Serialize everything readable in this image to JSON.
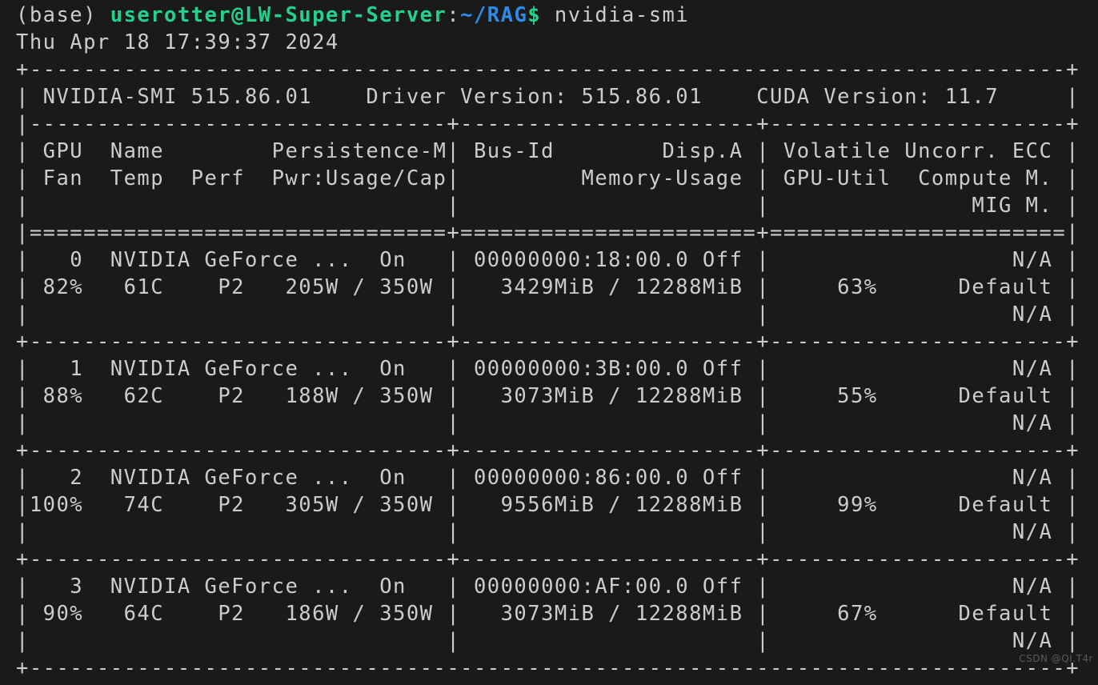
{
  "terminal": {
    "background_color": "#1a1a1a",
    "foreground_color": "#cccccc",
    "prompt_user_color": "#23d18b",
    "prompt_path_color": "#2e8ae8",
    "env_prefix": "(base) ",
    "user_host": "userotter@LW-Super-Server",
    "colon": ":",
    "path": "~/RAG",
    "dollar": "$",
    "command": " nvidia-smi",
    "timestamp": "Thu Apr 18 17:39:37 2024"
  },
  "smi": {
    "border_top": "+-----------------------------------------------------------------------------+",
    "banner": "| NVIDIA-SMI 515.86.01    Driver Version: 515.86.01    CUDA Version: 11.7     |",
    "banner_sep": "|-------------------------------+----------------------+----------------------+",
    "header_line_1": "| GPU  Name        Persistence-M| Bus-Id        Disp.A | Volatile Uncorr. ECC |",
    "header_line_2": "| Fan  Temp  Perf  Pwr:Usage/Cap|         Memory-Usage | GPU-Util  Compute M. |",
    "header_line_3": "|                               |                      |               MIG M. |",
    "header_sep": "|===============================+======================+======================|",
    "row_sep": "+-------------------------------+----------------------+----------------------+",
    "border_bottom": "+-----------------------------------------------------------------------------+",
    "version": "515.86.01",
    "driver_version": "515.86.01",
    "cuda_version": "11.7",
    "columns": [
      "GPU",
      "Name",
      "Persistence-M",
      "Bus-Id",
      "Disp.A",
      "Volatile Uncorr. ECC",
      "Fan",
      "Temp",
      "Perf",
      "Pwr:Usage/Cap",
      "Memory-Usage",
      "GPU-Util",
      "Compute M.",
      "MIG M."
    ],
    "gpus": [
      {
        "index": "0",
        "name": "NVIDIA GeForce ...",
        "persistence_m": "On",
        "bus_id": "00000000:18:00.0",
        "disp_a": "Off",
        "ecc": "N/A",
        "fan": "82%",
        "temp": "61C",
        "perf": "P2",
        "pwr_usage_cap": "205W / 350W",
        "memory_usage": "3429MiB / 12288MiB",
        "gpu_util": "63%",
        "compute_m": "Default",
        "mig_m": "N/A",
        "line1": "|   0  NVIDIA GeForce ...  On   | 00000000:18:00.0 Off |                  N/A |",
        "line2": "| 82%   61C    P2   205W / 350W |   3429MiB / 12288MiB |     63%      Default |",
        "line3": "|                               |                      |                  N/A |"
      },
      {
        "index": "1",
        "name": "NVIDIA GeForce ...",
        "persistence_m": "On",
        "bus_id": "00000000:3B:00.0",
        "disp_a": "Off",
        "ecc": "N/A",
        "fan": "88%",
        "temp": "62C",
        "perf": "P2",
        "pwr_usage_cap": "188W / 350W",
        "memory_usage": "3073MiB / 12288MiB",
        "gpu_util": "55%",
        "compute_m": "Default",
        "mig_m": "N/A",
        "line1": "|   1  NVIDIA GeForce ...  On   | 00000000:3B:00.0 Off |                  N/A |",
        "line2": "| 88%   62C    P2   188W / 350W |   3073MiB / 12288MiB |     55%      Default |",
        "line3": "|                               |                      |                  N/A |"
      },
      {
        "index": "2",
        "name": "NVIDIA GeForce ...",
        "persistence_m": "On",
        "bus_id": "00000000:86:00.0",
        "disp_a": "Off",
        "ecc": "N/A",
        "fan": "100%",
        "temp": "74C",
        "perf": "P2",
        "pwr_usage_cap": "305W / 350W",
        "memory_usage": "9556MiB / 12288MiB",
        "gpu_util": "99%",
        "compute_m": "Default",
        "mig_m": "N/A",
        "line1": "|   2  NVIDIA GeForce ...  On   | 00000000:86:00.0 Off |                  N/A |",
        "line2": "|100%   74C    P2   305W / 350W |   9556MiB / 12288MiB |     99%      Default |",
        "line3": "|                               |                      |                  N/A |"
      },
      {
        "index": "3",
        "name": "NVIDIA GeForce ...",
        "persistence_m": "On",
        "bus_id": "00000000:AF:00.0",
        "disp_a": "Off",
        "ecc": "N/A",
        "fan": "90%",
        "temp": "64C",
        "perf": "P2",
        "pwr_usage_cap": "186W / 350W",
        "memory_usage": "3073MiB / 12288MiB",
        "gpu_util": "67%",
        "compute_m": "Default",
        "mig_m": "N/A",
        "line1": "|   3  NVIDIA GeForce ...  On   | 00000000:AF:00.0 Off |                  N/A |",
        "line2": "| 90%   64C    P2   186W / 350W |   3073MiB / 12288MiB |     67%      Default |",
        "line3": "|                               |                      |                  N/A |"
      }
    ]
  },
  "watermark": "CSDN @QI.T4r"
}
